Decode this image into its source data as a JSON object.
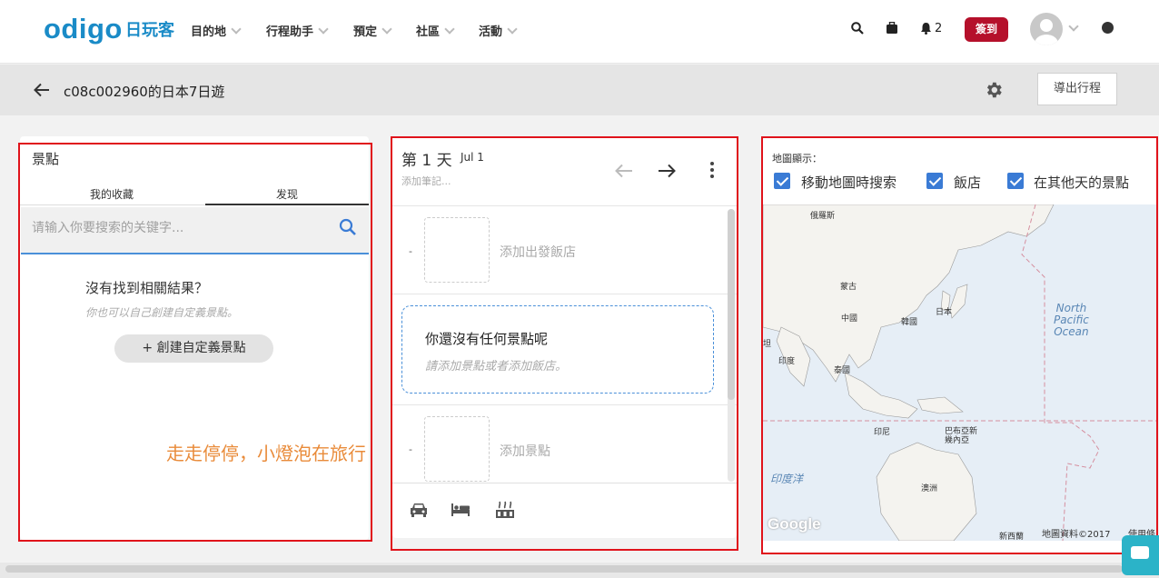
{
  "header": {
    "logo": "odigo",
    "logo_cn": "日玩客",
    "nav": [
      "目的地",
      "行程助手",
      "預定",
      "社區",
      "活動"
    ],
    "notification_count": "2",
    "signin_label": "簽到"
  },
  "trip": {
    "title": "c08c002960的日本7日遊",
    "export_label": "導出行程"
  },
  "left_panel": {
    "title": "景點",
    "tabs": [
      "我的收藏",
      "发现"
    ],
    "active_tab": "发现",
    "search_placeholder": "请输入你要搜索的关键字...",
    "no_result": "沒有找到相關結果？",
    "no_result_sub": "你也可以自己創建自定義景點。",
    "create_button": "+ 創建自定義景點"
  },
  "watermark": "走走停停，小燈泡在旅行",
  "day_panel": {
    "day_label": "第 1 天",
    "date": "Jul 1",
    "note_placeholder": "添加筆記...",
    "row_marker": "-",
    "add_hotel": "添加出發飯店",
    "empty_title": "你還沒有任何景點呢",
    "empty_sub": "請添加景點或者添加飯店。",
    "add_spot": "添加景點",
    "footer_icons": [
      "car-icon",
      "bed-icon",
      "hotspring-icon"
    ]
  },
  "map_panel": {
    "label": "地圖顯示：",
    "options": [
      {
        "label": "移動地圖時搜索",
        "checked": true
      },
      {
        "label": "飯店",
        "checked": true
      },
      {
        "label": "在其他天的景點",
        "checked": true
      }
    ],
    "places": {
      "russia": "俄羅斯",
      "mongolia": "蒙古",
      "china": "中國",
      "korea": "韓國",
      "japan": "日本",
      "india": "印度",
      "thailand": "泰國",
      "partial": "坦",
      "indonesia": "印尼",
      "png": "巴布亞新\n幾內亞",
      "australia": "澳洲",
      "indian_ocean": "印度洋",
      "nz": "新西蘭",
      "pacific": "North\nPacific\nOcean"
    },
    "google": "Google",
    "credit": "地圖資料©2017",
    "terms": "使用條"
  },
  "colors": {
    "brand": "#1a8bc7",
    "signin": "#b5102b",
    "checkbox": "#3a7bd5",
    "highlight_box": "#e0131b",
    "watermark": "#e98b3a"
  }
}
